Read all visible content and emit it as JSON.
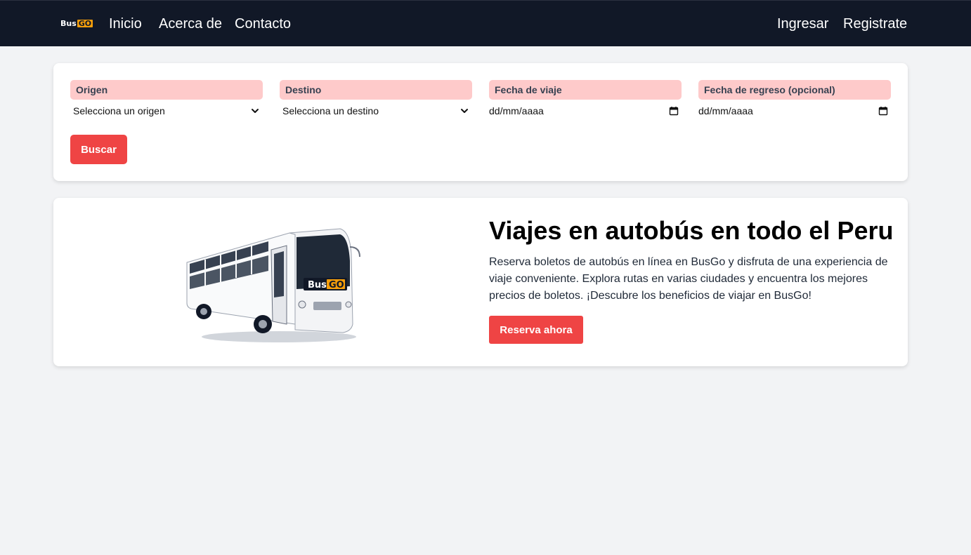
{
  "navbar": {
    "logo_primary": "Bus",
    "logo_accent": "GO",
    "links": [
      "Inicio",
      "Acerca de",
      "Contacto"
    ],
    "auth": {
      "login": "Ingresar",
      "register": "Registrate"
    }
  },
  "search": {
    "origen": {
      "label": "Origen",
      "value": "Selecciona un origen"
    },
    "destino": {
      "label": "Destino",
      "value": "Selecciona un destino"
    },
    "fecha_viaje": {
      "label": "Fecha de viaje",
      "value": "dd/mm/aaaa"
    },
    "fecha_regreso": {
      "label": "Fecha de regreso (opcional)",
      "value": "dd/mm/aaaa"
    },
    "button": "Buscar"
  },
  "hero": {
    "title": "Viajes en autobús en todo el Peru",
    "description": "Reserva boletos de autobús en línea en BusGo y disfruta de una experiencia de viaje conveniente. Explora rutas en varias ciudades y encuentra los mejores precios de boletos. ¡Descubre los beneficios de viajar en BusGo!",
    "button": "Reserva ahora",
    "bus_logo_primary": "Bus",
    "bus_logo_accent": "GO"
  },
  "colors": {
    "navbar": "#111827",
    "accent": "#ef4444",
    "label_bg": "#fecaca",
    "logo_accent": "#f59e0b",
    "page_bg": "#f2f3f5"
  },
  "icons": [
    "chevron-down-icon",
    "calendar-icon",
    "bus-illustration"
  ]
}
